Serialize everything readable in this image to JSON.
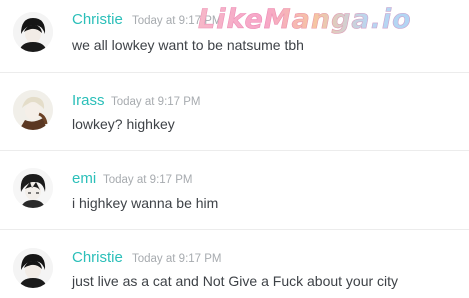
{
  "watermark": {
    "text": "LikeManga.io"
  },
  "messages": [
    {
      "author": "Christie",
      "time": "Today at 9:17 PM",
      "text": "we all lowkey want to be natsume tbh"
    },
    {
      "author": "Irass",
      "time": "Today at 9:17 PM",
      "text": "lowkey? highkey"
    },
    {
      "author": "emi",
      "time": "Today at 9:17 PM",
      "text": "i highkey wanna be him"
    },
    {
      "author": "Christie",
      "time": "Today at 9:17 PM",
      "text": "just live as a cat and Not Give a Fuck about your city"
    }
  ],
  "colors": {
    "author": "#2bbfb9",
    "time": "#a7abaf",
    "text": "#3e4247",
    "divider": "#ececec"
  }
}
